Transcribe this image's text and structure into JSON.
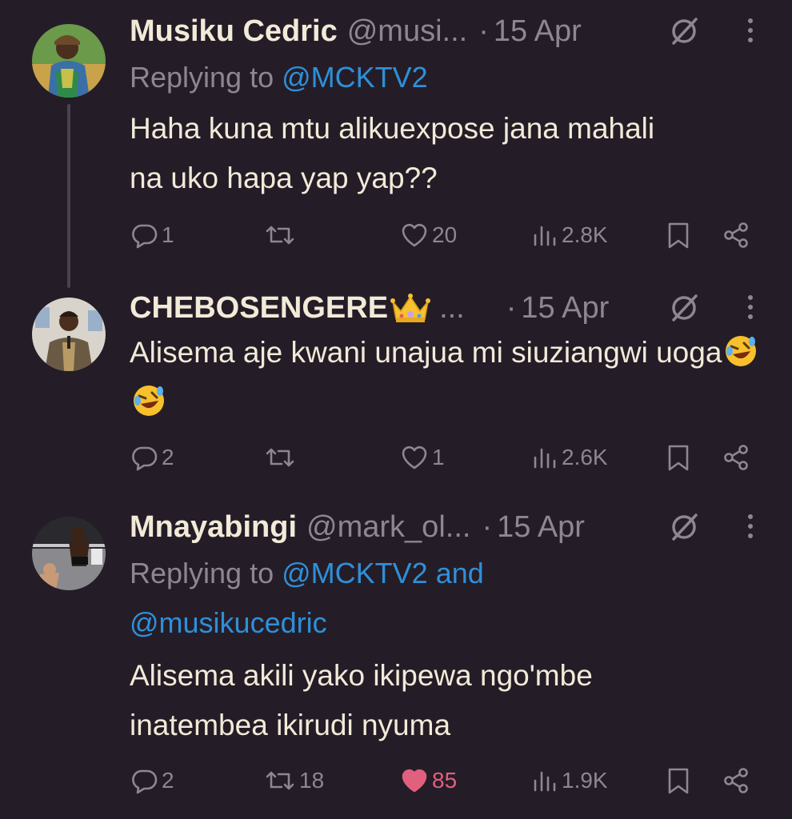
{
  "tweets": [
    {
      "name": "Musiku Cedric",
      "handle": "@musi...",
      "dot": "·",
      "date": "15 Apr",
      "replying_prefix": "Replying to",
      "replying_mentions": "@MCKTV2",
      "text": "Haha kuna mtu alikuexpose jana mahali na uko hapa yap yap??",
      "replies": "1",
      "retweets": "",
      "likes": "20",
      "views": "2.8K",
      "liked": false
    },
    {
      "name": "CHEBOSENGERE",
      "name_emoji": "crown-emoji",
      "handle": "...",
      "dot": "·",
      "date": "15 Apr",
      "text": "Alisema aje kwani unajua mi siuziangwi uoga",
      "text_emoji": [
        "rolling-on-floor-laughing-emoji",
        "rolling-on-floor-laughing-emoji"
      ],
      "replies": "2",
      "retweets": "",
      "likes": "1",
      "views": "2.6K",
      "liked": false
    },
    {
      "name": "Mnayabingi",
      "handle": "@mark_ol...",
      "dot": "·",
      "date": "15 Apr",
      "replying_prefix": "Replying to",
      "replying_mentions": "@MCKTV2 and",
      "replying_mentions_2": "@musikucedric",
      "text_line1": "Alisema akili yako ikipewa ngo'mbe",
      "text_line2": "inatembea ikirudi nyuma",
      "replies": "2",
      "retweets": "18",
      "likes": "85",
      "views": "1.9K",
      "liked": true
    }
  ],
  "colors": {
    "background": "#241d27",
    "text": "#f2ead8",
    "secondary": "#8e8692",
    "link": "#2f8fd8",
    "like": "#e0607e"
  },
  "icons": {
    "reply": "reply-icon",
    "retweet": "retweet-icon",
    "like": "heart-icon",
    "views": "views-icon",
    "bookmark": "bookmark-icon",
    "share": "share-icon",
    "grok": "grok-icon",
    "more": "more-icon"
  }
}
